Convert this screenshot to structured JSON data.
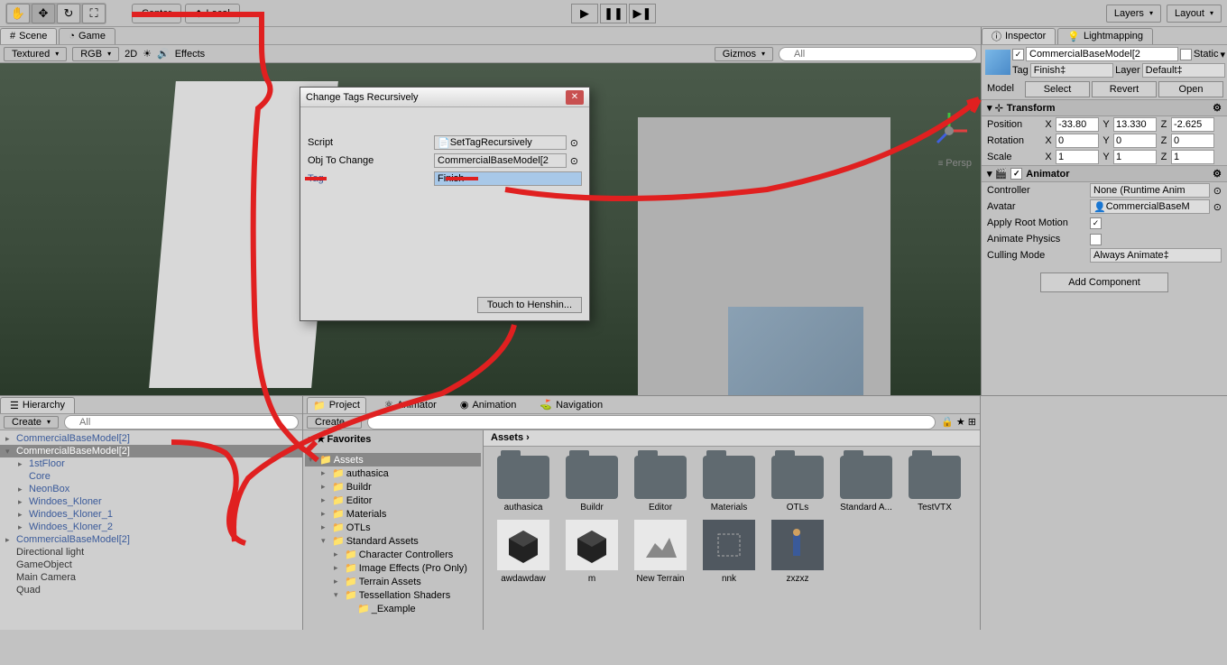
{
  "toolbar": {
    "center": "Center",
    "local": "Local",
    "layers": "Layers",
    "layout": "Layout"
  },
  "tabs": {
    "scene": "Scene",
    "game": "Game",
    "inspector": "Inspector",
    "lightmapping": "Lightmapping"
  },
  "sceneToolbar": {
    "textured": "Textured",
    "rgb": "RGB",
    "twoD": "2D",
    "effects": "Effects",
    "gizmos": "Gizmos",
    "search": "All"
  },
  "persp": "Persp",
  "inspector": {
    "name": "CommercialBaseModel[2",
    "static": "Static",
    "tag": "Tag",
    "tagValue": "Finish",
    "layer": "Layer",
    "layerValue": "Default",
    "model": "Model",
    "select": "Select",
    "revert": "Revert",
    "open": "Open",
    "transform": "Transform",
    "position": "Position",
    "rotation": "Rotation",
    "scale": "Scale",
    "px": "-33.80",
    "py": "13.330",
    "pz": "-2.625",
    "rx": "0",
    "ry": "0",
    "rz": "0",
    "sx": "1",
    "sy": "1",
    "sz": "1",
    "animator": "Animator",
    "controller": "Controller",
    "controllerValue": "None (Runtime Anim",
    "avatar": "Avatar",
    "avatarValue": "CommercialBaseM",
    "applyRootMotion": "Apply Root Motion",
    "animatePhysics": "Animate Physics",
    "cullingMode": "Culling Mode",
    "cullingValue": "Always Animate",
    "addComponent": "Add Component"
  },
  "dialog": {
    "title": "Change Tags Recursively",
    "script": "Script",
    "scriptValue": "SetTagRecursively",
    "objToChange": "Obj To Change",
    "objValue": "CommercialBaseModel[2",
    "tag": "Tag",
    "tagValue": "Finish",
    "button": "Touch to Henshin..."
  },
  "hierarchy": {
    "title": "Hierarchy",
    "create": "Create",
    "searchPlaceholder": "All",
    "items": [
      {
        "label": "CommercialBaseModel[2]",
        "indent": 0,
        "arrow": "▸",
        "dark": false
      },
      {
        "label": "CommercialBaseModel[2]",
        "indent": 0,
        "arrow": "▾",
        "dark": false,
        "selected": true
      },
      {
        "label": "1stFloor",
        "indent": 1,
        "arrow": "▸",
        "dark": false
      },
      {
        "label": "Core",
        "indent": 1,
        "arrow": "",
        "dark": false
      },
      {
        "label": "NeonBox",
        "indent": 1,
        "arrow": "▸",
        "dark": false
      },
      {
        "label": "Windoes_Kloner",
        "indent": 1,
        "arrow": "▸",
        "dark": false
      },
      {
        "label": "Windoes_Kloner_1",
        "indent": 1,
        "arrow": "▸",
        "dark": false
      },
      {
        "label": "Windoes_Kloner_2",
        "indent": 1,
        "arrow": "▸",
        "dark": false
      },
      {
        "label": "CommercialBaseModel[2]",
        "indent": 0,
        "arrow": "▸",
        "dark": false
      },
      {
        "label": "Directional light",
        "indent": 0,
        "arrow": "",
        "dark": true
      },
      {
        "label": "GameObject",
        "indent": 0,
        "arrow": "",
        "dark": true
      },
      {
        "label": "Main Camera",
        "indent": 0,
        "arrow": "",
        "dark": true
      },
      {
        "label": "Quad",
        "indent": 0,
        "arrow": "",
        "dark": true
      }
    ]
  },
  "project": {
    "tabs": {
      "project": "Project",
      "animator": "Animator",
      "animation": "Animation",
      "navigation": "Navigation"
    },
    "create": "Create",
    "favorites": "Favorites",
    "assetsLabel": "Assets",
    "tree": [
      {
        "label": "Assets",
        "indent": 0,
        "arrow": "▾",
        "sel": true
      },
      {
        "label": "authasica",
        "indent": 1,
        "arrow": "▸"
      },
      {
        "label": "Buildr",
        "indent": 1,
        "arrow": "▸"
      },
      {
        "label": "Editor",
        "indent": 1,
        "arrow": "▸"
      },
      {
        "label": "Materials",
        "indent": 1,
        "arrow": "▸"
      },
      {
        "label": "OTLs",
        "indent": 1,
        "arrow": "▸"
      },
      {
        "label": "Standard Assets",
        "indent": 1,
        "arrow": "▾"
      },
      {
        "label": "Character Controllers",
        "indent": 2,
        "arrow": "▸"
      },
      {
        "label": "Image Effects (Pro Only)",
        "indent": 2,
        "arrow": "▸"
      },
      {
        "label": "Terrain Assets",
        "indent": 2,
        "arrow": "▸"
      },
      {
        "label": "Tessellation Shaders",
        "indent": 2,
        "arrow": "▾"
      },
      {
        "label": "_Example",
        "indent": 3,
        "arrow": ""
      }
    ],
    "breadcrumb": "Assets ›",
    "assets": [
      {
        "label": "authasica",
        "type": "folder"
      },
      {
        "label": "Buildr",
        "type": "folder"
      },
      {
        "label": "Editor",
        "type": "folder"
      },
      {
        "label": "Materials",
        "type": "folder"
      },
      {
        "label": "OTLs",
        "type": "folder"
      },
      {
        "label": "Standard A...",
        "type": "folder"
      },
      {
        "label": "TestVTX",
        "type": "folder"
      },
      {
        "label": "awdawdaw",
        "type": "unity"
      },
      {
        "label": "m",
        "type": "unity"
      },
      {
        "label": "New Terrain",
        "type": "terrain"
      },
      {
        "label": "nnk",
        "type": "asset"
      },
      {
        "label": "zxzxz",
        "type": "prefab"
      }
    ]
  }
}
